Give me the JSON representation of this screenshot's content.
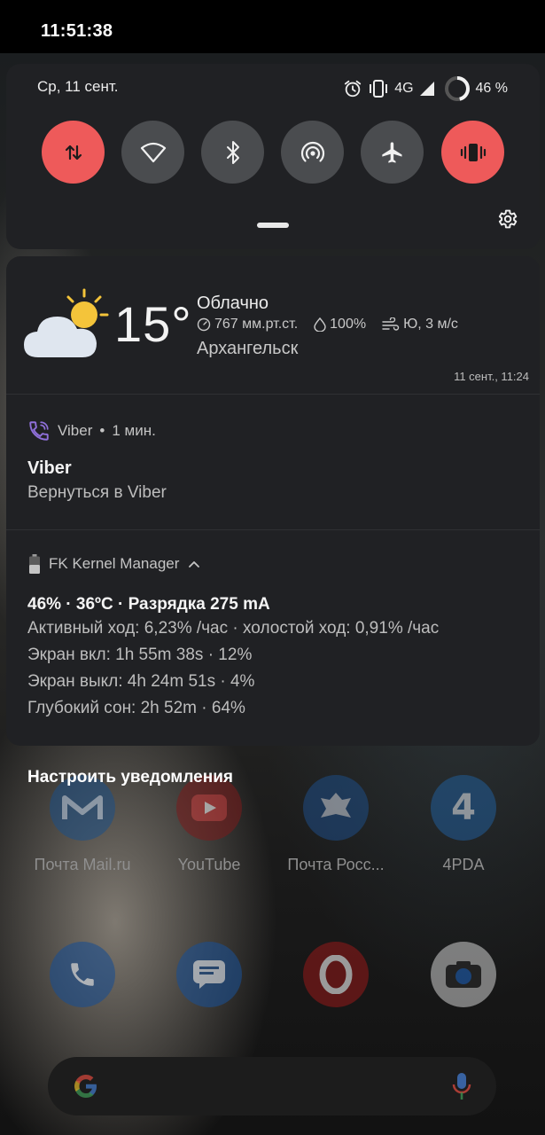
{
  "status_bar": {
    "time": "11:51:38"
  },
  "quick_settings": {
    "date": "Ср, 11 сент.",
    "network": "4G",
    "battery_percent": "46 %",
    "battery_level": 0.46,
    "tiles": [
      {
        "name": "mobile-data",
        "icon": "arrows-up-down-icon",
        "active": true
      },
      {
        "name": "wifi",
        "icon": "wifi-icon",
        "active": false
      },
      {
        "name": "bluetooth",
        "icon": "bluetooth-icon",
        "active": false
      },
      {
        "name": "hotspot",
        "icon": "hotspot-icon",
        "active": false
      },
      {
        "name": "airplane",
        "icon": "airplane-icon",
        "active": false
      },
      {
        "name": "vibrate",
        "icon": "vibrate-icon",
        "active": true
      }
    ],
    "active_color": "#ee5a5a",
    "inactive_color": "#4a4c4f"
  },
  "weather": {
    "temperature": "15°",
    "condition": "Облачно",
    "pressure": "767 мм.рт.ст.",
    "humidity": "100%",
    "wind": "Ю, 3 м/с",
    "city": "Архангельск",
    "updated": "11 сент., 11:24"
  },
  "viber": {
    "app_name": "Viber",
    "time_ago": "1 мин.",
    "title": "Viber",
    "text": "Вернуться в Viber"
  },
  "fk_kernel": {
    "app_name": "FK Kernel Manager",
    "title": "46% · 36ºC · Разрядка 275 mA",
    "lines": [
      "Активный ход: 6,23% /час · холостой ход: 0,91% /час",
      "Экран вкл: 1h 55m 38s  · 12%",
      "Экран выкл: 4h 24m 51s  · 4%",
      "Глубокий сон: 2h 52m  · 64%"
    ]
  },
  "manage_notifications": "Настроить уведомления",
  "home_apps": [
    {
      "label": "Почта Mail.ru",
      "icon": "mail-icon"
    },
    {
      "label": "YouTube",
      "icon": "youtube-icon"
    },
    {
      "label": "Почта Росс...",
      "icon": "russian-post-icon"
    },
    {
      "label": "4PDA",
      "icon": "4pda-icon"
    }
  ],
  "dock_apps": [
    {
      "icon": "phone-icon"
    },
    {
      "icon": "messages-icon"
    },
    {
      "icon": "opera-mini-icon"
    },
    {
      "icon": "camera-icon"
    }
  ]
}
